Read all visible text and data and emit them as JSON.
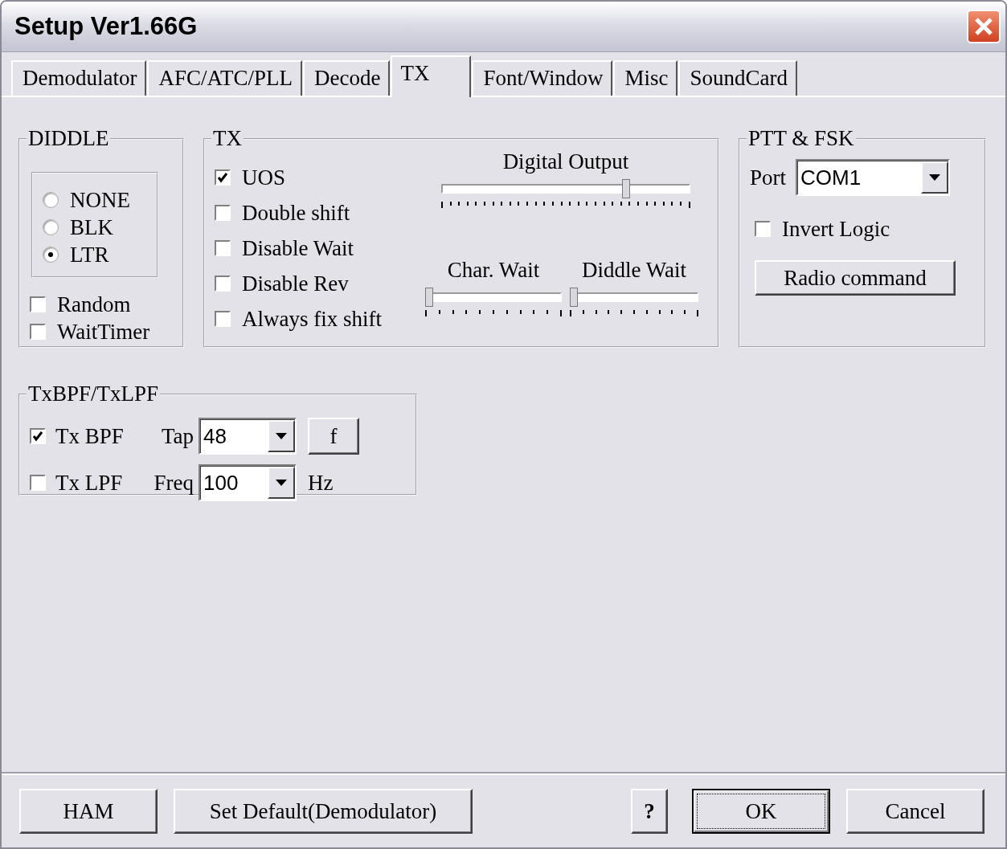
{
  "window": {
    "title": "Setup Ver1.66G"
  },
  "tabs": [
    {
      "label": "Demodulator",
      "selected": false
    },
    {
      "label": "AFC/ATC/PLL",
      "selected": false
    },
    {
      "label": "Decode",
      "selected": false
    },
    {
      "label": "TX",
      "selected": true
    },
    {
      "label": "Font/Window",
      "selected": false
    },
    {
      "label": "Misc",
      "selected": false
    },
    {
      "label": "SoundCard",
      "selected": false
    }
  ],
  "diddle": {
    "title": "DIDDLE",
    "modes": [
      {
        "label": "NONE",
        "selected": false
      },
      {
        "label": "BLK",
        "selected": false
      },
      {
        "label": "LTR",
        "selected": true
      }
    ],
    "options": [
      {
        "label": "Random",
        "checked": false
      },
      {
        "label": "WaitTimer",
        "checked": false
      }
    ]
  },
  "tx": {
    "title": "TX",
    "options": [
      {
        "label": "UOS",
        "checked": true
      },
      {
        "label": "Double shift",
        "checked": false
      },
      {
        "label": "Disable Wait",
        "checked": false
      },
      {
        "label": "Disable Rev",
        "checked": false
      },
      {
        "label": "Always fix shift",
        "checked": false
      }
    ],
    "sliders": [
      {
        "label": "Digital Output",
        "level": 0.75
      },
      {
        "label": "Char. Wait",
        "level": 0
      },
      {
        "label": "Diddle Wait",
        "level": 0
      }
    ]
  },
  "ptt_fsk": {
    "title": "PTT & FSK",
    "port_label": "Port",
    "port_value": "COM1",
    "invert_logic": {
      "label": "Invert Logic",
      "checked": false
    },
    "radio_command": "Radio command"
  },
  "filters": {
    "title": "TxBPF/TxLPF",
    "rows": [
      {
        "label": "Tx BPF",
        "checked": true,
        "field_label": "Tap",
        "value": "48",
        "button": "f"
      },
      {
        "label": "Tx LPF",
        "checked": false,
        "field_label": "Freq",
        "value": "100",
        "unit": "Hz"
      }
    ]
  },
  "buttons": [
    {
      "label": "HAM",
      "focused": false
    },
    {
      "label": "Set Default(Demodulator)",
      "focused": false
    },
    {
      "label": "?",
      "focused": false
    },
    {
      "label": "OK",
      "focused": true
    },
    {
      "label": "Cancel",
      "focused": false
    }
  ]
}
